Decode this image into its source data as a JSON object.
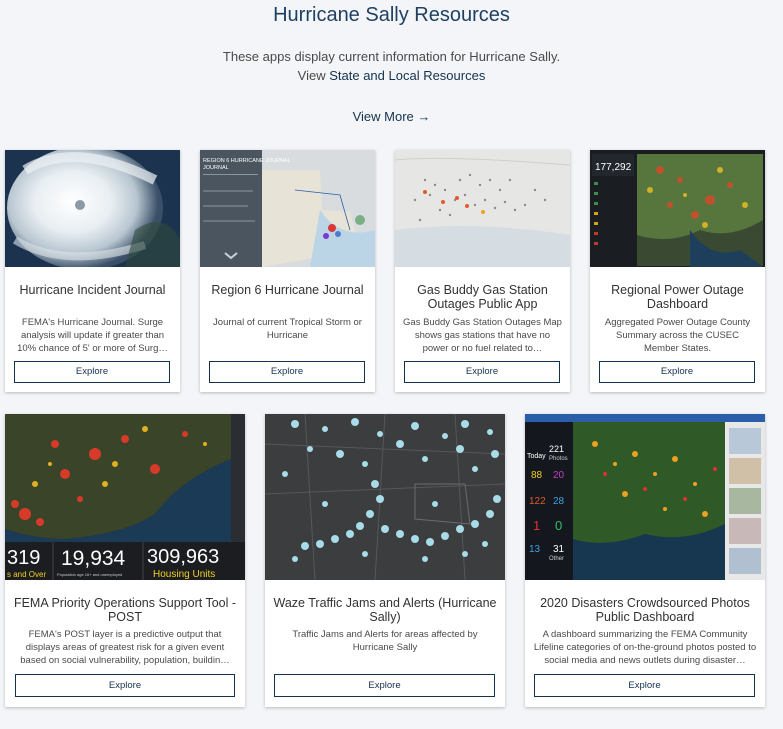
{
  "header": {
    "title": "Hurricane Sally Resources",
    "subtitle_line1": "These apps display current information for Hurricane Sally.",
    "subtitle_prefix": "View",
    "subtitle_link": "State and Local Resources",
    "view_more": "View More →"
  },
  "cards": [
    {
      "title": "Hurricane Incident Journal",
      "description": "FEMA's Hurricane Journal. Surge analysis will update if greater than 10% chance of 5' or more of Surg…",
      "button": "Explore"
    },
    {
      "title": "Region 6 Hurricane Journal",
      "description": "Journal of current Tropical Storm or Hurricane",
      "button": "Explore",
      "thumb_text": {
        "heading": "REGION 6 HURRICANE JOURNAL"
      }
    },
    {
      "title": "Gas Buddy Gas Station Outages Public App",
      "description": "Gas Buddy Gas Station Outages Map shows gas stations that have no power or no fuel related to…",
      "button": "Explore"
    },
    {
      "title": "Regional Power Outage Dashboard",
      "description": "Aggregated Power Outage County Summary across the CUSEC Member States.",
      "button": "Explore",
      "thumb_text": {
        "total": "177,292"
      }
    },
    {
      "title": "FEMA Priority Operations Support Tool - POST",
      "description": "FEMA's POST layer is a predictive output that displays areas of greatest risk for a given event based on social vulnerability, population, buildin…",
      "button": "Explore",
      "thumb_text": {
        "stat_left": "319",
        "stat_left_label": "s and Over",
        "stat_mid": "19,934",
        "stat_mid_label": "Population age 16+ and unemployed",
        "stat_right": "309,963",
        "stat_right_label": "Housing Units"
      }
    },
    {
      "title": "Waze Traffic Jams and Alerts (Hurricane Sally)",
      "description": "Traffic Jams and Alerts for areas affected by Hurricane Sally",
      "button": "Explore"
    },
    {
      "title": "2020 Disasters Crowdsourced Photos Public Dashboard",
      "description": "A dashboard summarizing the FEMA Community Lifeline categories of on-the-ground photos posted to social media and news outlets during disaster…",
      "button": "Explore",
      "thumb_text": {
        "today": "Today",
        "photos_value": "221",
        "photos_label": "Photos",
        "v1": "88",
        "v2": "20",
        "v3": "122",
        "v4": "28",
        "v5": "1",
        "v6": "0",
        "v7": "13",
        "v8": "31",
        "other": "Other"
      }
    }
  ]
}
